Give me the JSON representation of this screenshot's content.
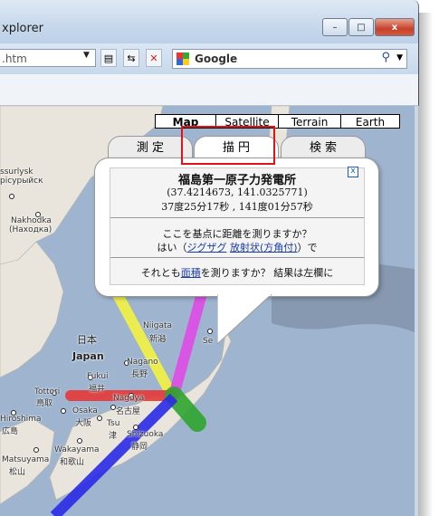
{
  "window": {
    "title": "xplorer",
    "controls": {
      "minimize": "–",
      "maximize": "□",
      "close": "x"
    }
  },
  "toolbar": {
    "address_value": ".htm",
    "search_label": "Google",
    "search_engine_icon": "google-icon"
  },
  "map": {
    "types": [
      "Map",
      "Satellite",
      "Terrain",
      "Earth"
    ],
    "active_type": "Map",
    "labels": {
      "irkutsk": "ssurlysk",
      "irkutsk_ru": "рісурыйск",
      "nakhodka": "Nakhodka",
      "nakhodka_ru": "(Находка)",
      "niigata": "Niigata",
      "niigata_jp": "新潟",
      "japan_jp": "日本",
      "japan": "Japan",
      "nagano": "Nagano",
      "nagano_jp": "長野",
      "fukui": "Fukui",
      "fukui_jp": "福井",
      "tottori": "Tottori",
      "tottori_jp": "鳥取",
      "nagoya": "Nagoya",
      "nagoya_jp": "名古屋",
      "osaka": "Osaka",
      "osaka_jp": "大阪",
      "hiroshima": "Hiroshima",
      "hiroshima_jp": "広島",
      "tsu": "Tsu",
      "tsu_jp": "津",
      "shizuoka": "Shizuoka",
      "shizuoka_jp": "静岡",
      "wakayama": "Wakayama",
      "wakayama_jp": "和歌山",
      "matsuyama": "Matsuyama",
      "matsuyama_jp": "松山",
      "se": "Se"
    }
  },
  "info": {
    "tabs": [
      "測 定",
      "描 円",
      "検 索"
    ],
    "place": "福島第一原子力発電所",
    "coords": "(37.4214673, 141.0325771)",
    "dms": "37度25分17秒 , 141度01分57秒",
    "question": "ここを基点に距離を測りますか？",
    "yes_prefix": "はい（",
    "link_zigzag": "ジグザグ",
    "link_radial": "放射状(方角付)",
    "yes_suffix": "）で",
    "area_prefix": "それとも",
    "link_area": "面積",
    "area_suffix": "を測りますか？ 結果は左欄に",
    "close": "x"
  },
  "colors": {
    "red_highlight": "#e0121a",
    "line_yellow": "#f4f442",
    "line_magenta": "#e04be6",
    "line_red": "#e63939",
    "line_green": "#2fa52f",
    "line_blue": "#2b2be6"
  }
}
